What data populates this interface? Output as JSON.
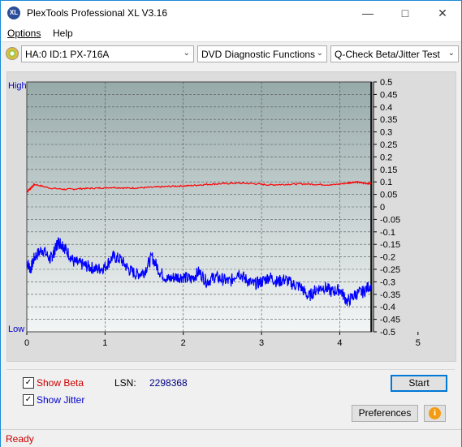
{
  "window": {
    "title": "PlexTools Professional XL V3.16",
    "icon_label": "XL"
  },
  "menu": [
    {
      "label": "Options",
      "underline": "O"
    },
    {
      "label": "Help",
      "underline": "H"
    }
  ],
  "toolbar": {
    "drive": "HA:0 ID:1  PX-716A",
    "function": "DVD Diagnostic Functions",
    "test": "Q-Check Beta/Jitter Test"
  },
  "chart_data": {
    "type": "line",
    "left_axis_labels": {
      "top": "High",
      "bottom": "Low"
    },
    "x_ticks": [
      "0",
      "1",
      "2",
      "3",
      "4",
      "5"
    ],
    "xlim": [
      0,
      5
    ],
    "right_ticks": [
      "0.5",
      "0.45",
      "0.4",
      "0.35",
      "0.3",
      "0.25",
      "0.2",
      "0.15",
      "0.1",
      "0.05",
      "0",
      "-0.05",
      "-0.1",
      "-0.15",
      "-0.2",
      "-0.25",
      "-0.3",
      "-0.35",
      "-0.4",
      "-0.45",
      "-0.5"
    ],
    "ylim": [
      -0.5,
      0.5
    ],
    "cursor_x": 4.4,
    "grid": true,
    "colors": {
      "beta": "#ff0000",
      "jitter": "#0000ff",
      "axis_text_left": "#0000cc"
    },
    "series": [
      {
        "name": "Beta",
        "x": [
          0,
          0.05,
          0.1,
          0.3,
          0.5,
          0.7,
          0.9,
          1.1,
          1.3,
          1.5,
          1.7,
          1.9,
          2.1,
          2.3,
          2.5,
          2.7,
          2.9,
          3.1,
          3.3,
          3.5,
          3.7,
          3.9,
          4.1,
          4.2,
          4.3,
          4.4
        ],
        "y": [
          0.06,
          0.075,
          0.09,
          0.075,
          0.07,
          0.073,
          0.075,
          0.078,
          0.075,
          0.077,
          0.08,
          0.083,
          0.085,
          0.09,
          0.093,
          0.095,
          0.093,
          0.088,
          0.09,
          0.092,
          0.09,
          0.088,
          0.095,
          0.1,
          0.095,
          0.093
        ]
      },
      {
        "name": "Jitter",
        "x": [
          0,
          0.05,
          0.1,
          0.2,
          0.3,
          0.35,
          0.4,
          0.45,
          0.5,
          0.6,
          0.7,
          0.8,
          0.9,
          1.0,
          1.1,
          1.2,
          1.3,
          1.4,
          1.5,
          1.6,
          1.7,
          1.8,
          1.9,
          2.0,
          2.1,
          2.2,
          2.3,
          2.4,
          2.5,
          2.6,
          2.7,
          2.8,
          2.9,
          3.0,
          3.1,
          3.2,
          3.3,
          3.4,
          3.5,
          3.6,
          3.7,
          3.8,
          3.9,
          4.0,
          4.1,
          4.2,
          4.3,
          4.4
        ],
        "y": [
          -0.22,
          -0.25,
          -0.2,
          -0.17,
          -0.21,
          -0.18,
          -0.14,
          -0.15,
          -0.17,
          -0.22,
          -0.23,
          -0.24,
          -0.25,
          -0.24,
          -0.2,
          -0.21,
          -0.25,
          -0.27,
          -0.26,
          -0.2,
          -0.26,
          -0.29,
          -0.28,
          -0.28,
          -0.29,
          -0.26,
          -0.3,
          -0.28,
          -0.29,
          -0.3,
          -0.26,
          -0.29,
          -0.31,
          -0.3,
          -0.28,
          -0.3,
          -0.29,
          -0.31,
          -0.32,
          -0.36,
          -0.33,
          -0.32,
          -0.34,
          -0.33,
          -0.38,
          -0.35,
          -0.34,
          -0.31
        ]
      }
    ]
  },
  "panel": {
    "show_beta": {
      "label": "Show Beta",
      "checked": true,
      "color": "#cc0000"
    },
    "show_jitter": {
      "label": "Show Jitter",
      "checked": true,
      "color": "#0000cc"
    },
    "lsn_label": "LSN:",
    "lsn_value": "2298368",
    "start_label": "Start",
    "preferences_label": "Preferences",
    "info_icon": "i"
  },
  "status": {
    "text": "Ready",
    "color": "#cc0000"
  }
}
